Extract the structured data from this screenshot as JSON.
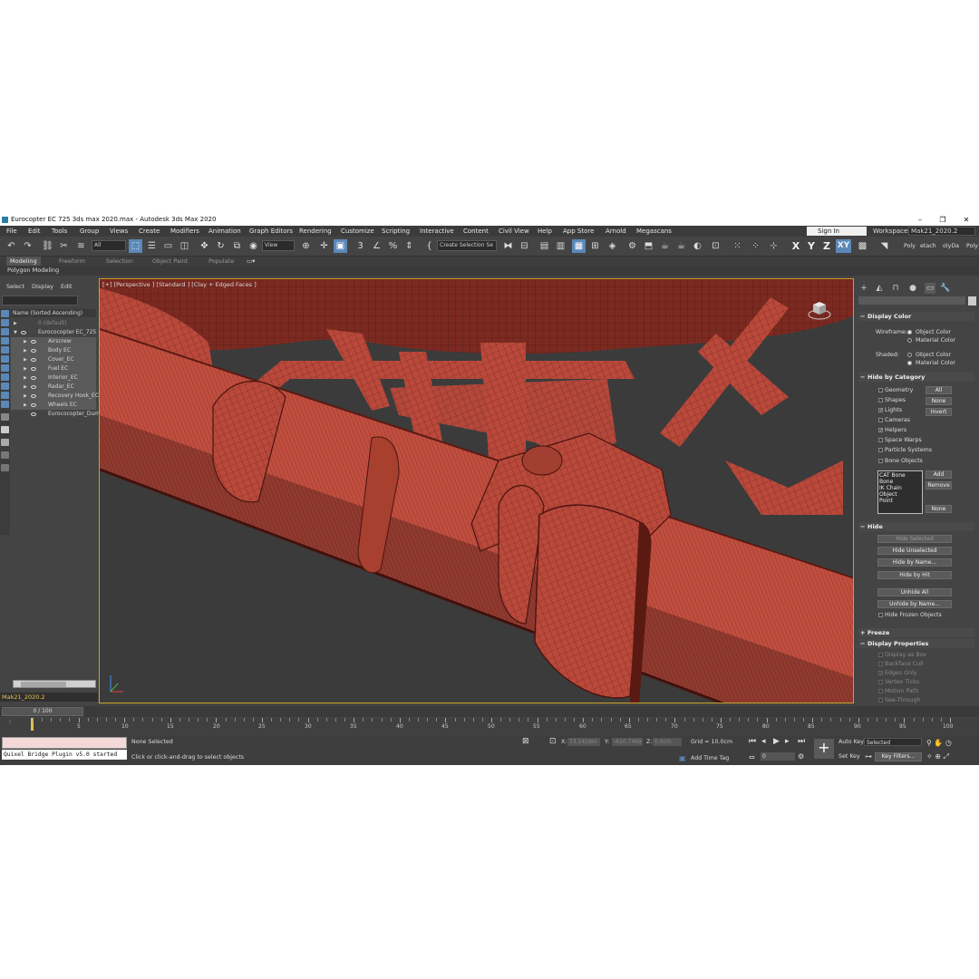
{
  "window": {
    "title": "Eurocopter EC 725 3ds max 2020.max - Autodesk 3ds Max 2020",
    "minimize": "–",
    "restore": "❐",
    "close": "✕"
  },
  "menu": [
    "File",
    "Edit",
    "Tools",
    "Group",
    "Views",
    "Create",
    "Modifiers",
    "Animation",
    "Graph Editors",
    "Rendering",
    "Customize",
    "Scripting",
    "Interactive",
    "Content",
    "Civil View",
    "Help",
    "App Store",
    "Arnold",
    "Megascans"
  ],
  "signin": "Sign In",
  "workspaces": {
    "label": "Workspaces:",
    "value": "Mak21_2020.2"
  },
  "toolbar": {
    "filter_value": "All",
    "refcoord_value": "View",
    "selection_set": "Create Selection Se",
    "axes": [
      "X",
      "Y",
      "Z",
      "XY"
    ],
    "right_tabs": [
      "Poly",
      "etach",
      "olyDa",
      "Poly"
    ]
  },
  "ribbon": {
    "tabs": [
      "Modeling",
      "Freeform",
      "Selection",
      "Object Paint",
      "Populate"
    ],
    "active": "Modeling",
    "subtitle": "Polygon Modeling"
  },
  "explorer": {
    "tabs": [
      "Select",
      "Display",
      "Edit"
    ],
    "header": "Name (Sorted Ascending)",
    "rows": [
      {
        "label": "0 (default)",
        "dim": true
      },
      {
        "label": "Eurococopter EC_725",
        "dim": false
      },
      {
        "label": "Airscrew",
        "dim": false
      },
      {
        "label": "Body EC",
        "dim": false
      },
      {
        "label": "Cover_EC",
        "dim": false
      },
      {
        "label": "Fuel EC",
        "dim": false
      },
      {
        "label": "Interior_EC",
        "dim": false
      },
      {
        "label": "Radar_EC",
        "dim": false
      },
      {
        "label": "Recovery Hook_EC",
        "dim": false
      },
      {
        "label": "Wheels EC",
        "dim": false
      },
      {
        "label": "Eurococopter_Dumm",
        "dim": false
      }
    ],
    "project": "Mak21_2020.2"
  },
  "viewport": {
    "label": "[+] [Perspective ] [Standard ] [Clay + Edged Faces ]",
    "mesh_color": "#b84a3c",
    "wire_color": "#6a1f16"
  },
  "command_panel": {
    "display_color": {
      "title": "Display Color",
      "wireframe_label": "Wireframe:",
      "shaded_label": "Shaded:",
      "object_color": "Object Color",
      "material_color": "Material Color"
    },
    "hide_by_category": {
      "title": "Hide by Category",
      "items": [
        {
          "label": "Geometry",
          "checked": false
        },
        {
          "label": "Shapes",
          "checked": false
        },
        {
          "label": "Lights",
          "checked": true
        },
        {
          "label": "Cameras",
          "checked": false
        },
        {
          "label": "Helpers",
          "checked": true
        },
        {
          "label": "Space Warps",
          "checked": false
        },
        {
          "label": "Particle Systems",
          "checked": false
        },
        {
          "label": "Bone Objects",
          "checked": false
        }
      ],
      "buttons": [
        "All",
        "None",
        "Invert"
      ],
      "list": [
        "CAT Bone",
        "Bone",
        "IK Chain Object",
        "Point"
      ],
      "list_buttons": [
        "Add",
        "Remove",
        "None"
      ]
    },
    "hide": {
      "title": "Hide",
      "buttons": [
        {
          "label": "Hide Selected",
          "enabled": false
        },
        {
          "label": "Hide Unselected",
          "enabled": true
        },
        {
          "label": "Hide by Name...",
          "enabled": true
        },
        {
          "label": "Hide by Hit",
          "enabled": true
        },
        {
          "label": "Unhide All",
          "enabled": true
        },
        {
          "label": "Unhide by Name...",
          "enabled": true
        }
      ],
      "frozen": "Hide Frozen Objects"
    },
    "freeze_title": "Freeze",
    "display_properties": {
      "title": "Display Properties",
      "items": [
        "Display as Box",
        "Backface Cull",
        "Edges Only",
        "Vertex Ticks",
        "Motion Path",
        "See-Through"
      ]
    }
  },
  "timeline": {
    "frame_field": "0 / 100",
    "ticks": [
      "5",
      "10",
      "15",
      "20",
      "25",
      "30",
      "35",
      "40",
      "45",
      "50",
      "55",
      "60",
      "65",
      "70",
      "75",
      "80",
      "85",
      "90",
      "95",
      "100"
    ]
  },
  "status": {
    "plugin": "Quixel Bridge Plugin v5.0 started",
    "selection": "None Selected",
    "prompt": "Click or click-and-drag to select objects",
    "x_label": "X:",
    "x_value": "73.1418m",
    "y_label": "Y:",
    "y_value": "-610.7469",
    "z_label": "Z:",
    "z_value": "0.0cm",
    "grid": "Grid = 10.0cm",
    "add_time_tag": "Add Time Tag",
    "auto_key": "Auto Key",
    "set_key": "Set Key",
    "selected": "Selected",
    "key_filters": "Key Filters...",
    "frame": "0"
  }
}
